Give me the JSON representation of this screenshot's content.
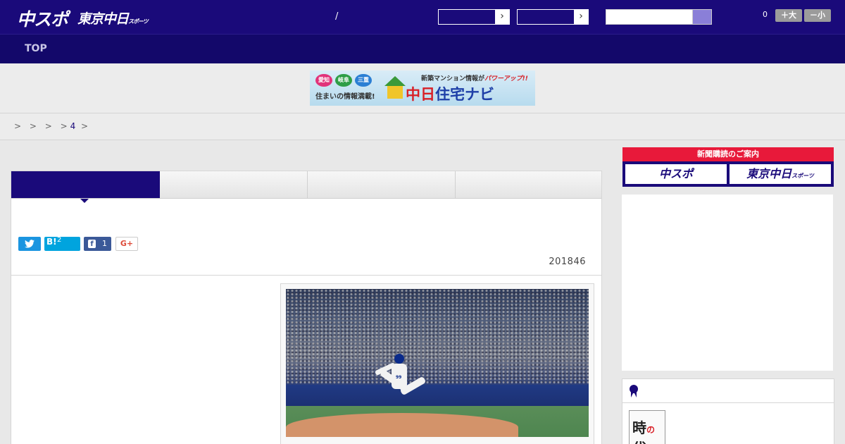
{
  "header": {
    "logo_primary": "中スポ",
    "logo_secondary": "東京中日",
    "logo_secondary_suffix": "スポーツ",
    "separator": "/",
    "select1_arrow": "›",
    "select2_arrow": "›",
    "font_count": "0",
    "font_big_label": "＋大",
    "font_small_label": "－小"
  },
  "nav": {
    "items": [
      {
        "label": "TOP"
      }
    ]
  },
  "banner": {
    "badges": [
      "愛知",
      "岐阜",
      "三重"
    ],
    "subtitle": "住まいの情報満載!",
    "top_text": "新築マンション情報が",
    "top_emphasis": "パワーアップ!!",
    "main_part1": "中",
    "main_part2": "日",
    "main_part3": "住宅ナビ"
  },
  "breadcrumb": {
    "sep1": ">",
    "sep2": ">",
    "sep3": ">",
    "sep4": ">",
    "link": "4",
    "sep5": ">"
  },
  "article": {
    "share": {
      "twitter_icon": "twitter-bird",
      "hatena_label": "B!",
      "hatena_count": "2",
      "facebook_label": "f",
      "facebook_count": "1",
      "gplus_label": "G+"
    },
    "date": "201846",
    "photo_number": "99"
  },
  "sidebar": {
    "subscribe_header": "新聞購読のご案内",
    "subscribe_btn1": "中スポ",
    "subscribe_btn2": "東京中日",
    "subscribe_btn2_suffix": "スポーツ",
    "thumb_text1": "時",
    "thumb_text2": "の",
    "thumb_text3": "代"
  },
  "colors": {
    "brand_navy": "#1a0a7a",
    "subscribe_red": "#e8193a",
    "twitter_blue": "#1b95e0",
    "hatena_blue": "#00a4de",
    "facebook_blue": "#3b5998"
  }
}
